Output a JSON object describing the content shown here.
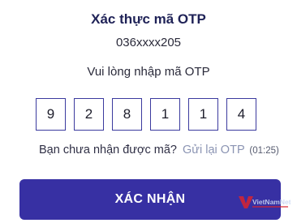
{
  "header": {
    "title": "Xác thực mã OTP",
    "phone": "036xxxx205"
  },
  "prompt": "Vui lòng nhập mã OTP",
  "otp": {
    "digits": [
      "9",
      "2",
      "8",
      "1",
      "1",
      "4"
    ]
  },
  "resend": {
    "question": "Bạn chưa nhận được mã?",
    "link_label": "Gửi lại OTP",
    "countdown": "(01:25)"
  },
  "confirm_button": {
    "label": "XÁC NHẬN"
  },
  "watermark": {
    "text": "VietNamNet"
  },
  "colors": {
    "primary": "#3730a3",
    "otp_border": "#3b3a9e",
    "link_muted": "#8b94b3"
  }
}
